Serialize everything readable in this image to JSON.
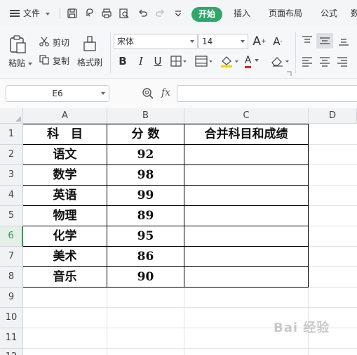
{
  "menubar": {
    "file_label": "文件",
    "tabs": [
      "开始",
      "插入",
      "页面布局",
      "公式",
      "数"
    ],
    "active_tab_color": "#31a66b"
  },
  "ribbon": {
    "paste_label": "粘贴",
    "cut_label": "剪切",
    "copy_label": "复制",
    "format_painter_label": "格式刷",
    "font_name": "宋体",
    "font_size": "14",
    "grow_font": "A",
    "shrink_font": "A",
    "bold": "B",
    "italic": "I",
    "underline": "U",
    "font_color_letter": "A"
  },
  "formula_bar": {
    "name_box": "E6",
    "fx_label": "fx",
    "formula_value": ""
  },
  "sheet": {
    "columns": [
      "A",
      "B",
      "C",
      "D"
    ],
    "rows": [
      "1",
      "2",
      "3",
      "4",
      "5",
      "6",
      "7",
      "8",
      "9",
      "10",
      "11",
      "12"
    ],
    "active_row": "6",
    "header": [
      "科　目",
      "分 数",
      "合并科目和成绩"
    ],
    "data": [
      [
        "语文",
        "92",
        ""
      ],
      [
        "数学",
        "98",
        ""
      ],
      [
        "英语",
        "99",
        ""
      ],
      [
        "物理",
        "89",
        ""
      ],
      [
        "化学",
        "95",
        ""
      ],
      [
        "美术",
        "86",
        ""
      ],
      [
        "音乐",
        "90",
        ""
      ]
    ]
  },
  "watermark": "Bai 经验"
}
